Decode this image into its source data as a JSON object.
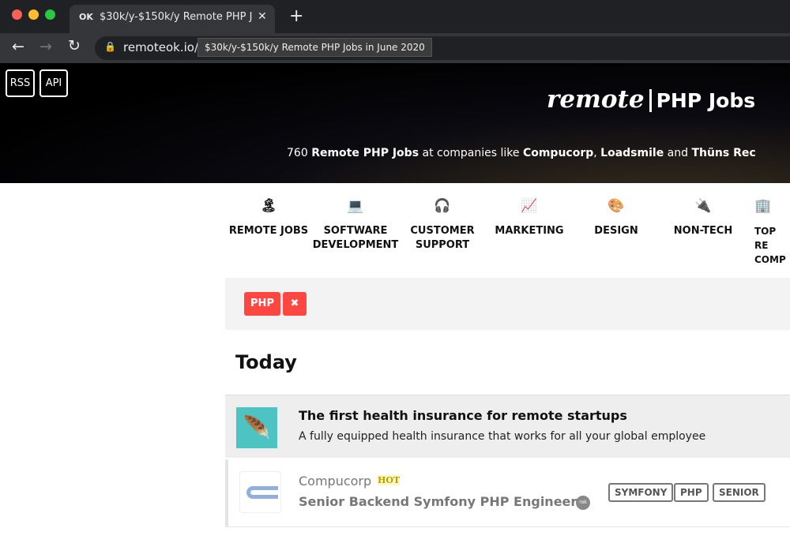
{
  "browser": {
    "tab_favicon": "OK",
    "tab_title": "$30k/y-$150k/y Remote PHP J",
    "new_tab": "+",
    "close": "✕",
    "url": "remoteok.io/r",
    "tooltip": "$30k/y-$150k/y Remote PHP Jobs in June 2020"
  },
  "header": {
    "rss": "RSS",
    "api": "API",
    "logo_word": "remote",
    "logo_suffix": "PHP Jobs",
    "sub_count": "760",
    "sub_bold": "Remote PHP Jobs",
    "sub_mid": "at companies like",
    "company1": "Compucorp",
    "company2": "Loadsmile",
    "sub_and": "and",
    "company3": "Thüns Rec"
  },
  "nav": [
    {
      "icon": "🏝",
      "label": "REMOTE JOBS"
    },
    {
      "icon": "💻",
      "label": "SOFTWARE DEVELOPMENT"
    },
    {
      "icon": "🎧",
      "label": "CUSTOMER SUPPORT"
    },
    {
      "icon": "📈",
      "label": "MARKETING"
    },
    {
      "icon": "🎨",
      "label": "DESIGN"
    },
    {
      "icon": "🔌",
      "label": "NON-TECH"
    },
    {
      "icon": "🏢",
      "label": "TOP RE COMP"
    }
  ],
  "filter": {
    "tag": "PHP",
    "remove": "✖"
  },
  "section": "Today",
  "ad": {
    "title": "The first health insurance for remote startups",
    "desc": "A fully equipped health insurance that works for all your global employee"
  },
  "job": {
    "company": "Compucorp",
    "badge": "HOT",
    "title": "Senior Backend Symfony PHP Engineer",
    "verified": "rok",
    "tags": [
      "SYMFONY",
      "PHP",
      "SENIOR"
    ]
  },
  "colors": {
    "accent": "#ff4742",
    "ad_icon": "#4dc3c3"
  }
}
